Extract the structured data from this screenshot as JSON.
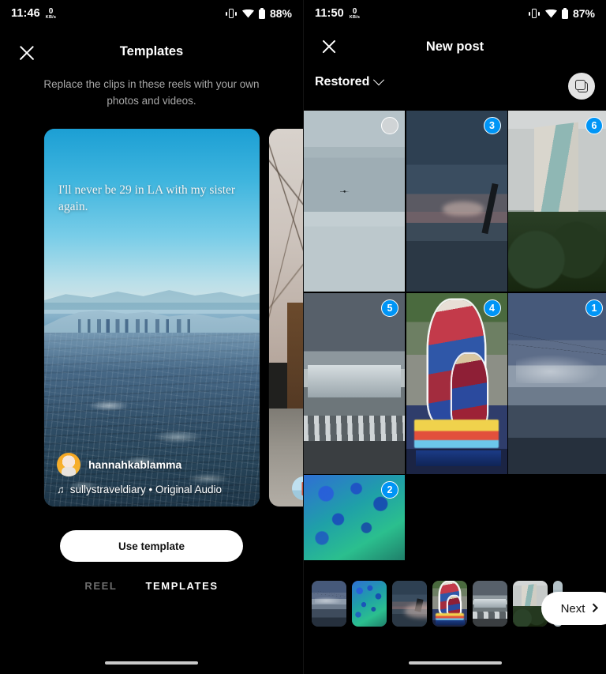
{
  "left": {
    "status": {
      "time": "11:46",
      "net_speed": "0",
      "net_unit": "KB/s",
      "battery": "88%"
    },
    "header": {
      "close_label": "×",
      "title": "Templates",
      "subtitle": "Replace the clips in these reels with your own photos and videos."
    },
    "reel": {
      "caption": "I'll never be 29 in LA with my sister again.",
      "username": "hannahkablamma",
      "audio": "sullystraveldiary • Original Audio",
      "note_glyph": "♫"
    },
    "use_template_label": "Use template",
    "tabs": [
      {
        "label": "REEL",
        "active": false
      },
      {
        "label": "TEMPLATES",
        "active": true
      }
    ]
  },
  "right": {
    "status": {
      "time": "11:50",
      "net_speed": "0",
      "net_unit": "KB/s",
      "battery": "87%"
    },
    "header": {
      "close_label": "×",
      "title": "New post"
    },
    "album": {
      "name": "Restored",
      "chevron": "chevron-down-icon"
    },
    "multiselect_icon": "layers-icon",
    "grid": [
      {
        "id": "tile-1",
        "art": "a-plane",
        "selected": false,
        "badge": ""
      },
      {
        "id": "tile-2",
        "art": "a-storm",
        "selected": true,
        "badge": "3"
      },
      {
        "id": "tile-3",
        "art": "a-bldg",
        "selected": true,
        "badge": "6"
      },
      {
        "id": "tile-4",
        "art": "a-mall",
        "selected": true,
        "badge": "5"
      },
      {
        "id": "tile-5",
        "art": "a-thor",
        "selected": true,
        "badge": "4"
      },
      {
        "id": "tile-6",
        "art": "a-lake",
        "selected": true,
        "badge": "1"
      },
      {
        "id": "tile-7",
        "art": "a-abstract",
        "selected": true,
        "badge": "2"
      }
    ],
    "filmstrip": [
      {
        "order": "1",
        "art": "a-lake"
      },
      {
        "order": "2",
        "art": "a-abstract"
      },
      {
        "order": "3",
        "art": "a-storm"
      },
      {
        "order": "4",
        "art": "a-thor"
      },
      {
        "order": "5",
        "art": "a-mall"
      },
      {
        "order": "6",
        "art": "a-bldg"
      }
    ],
    "next_label": "Next",
    "accent_color": "#0095f6"
  }
}
